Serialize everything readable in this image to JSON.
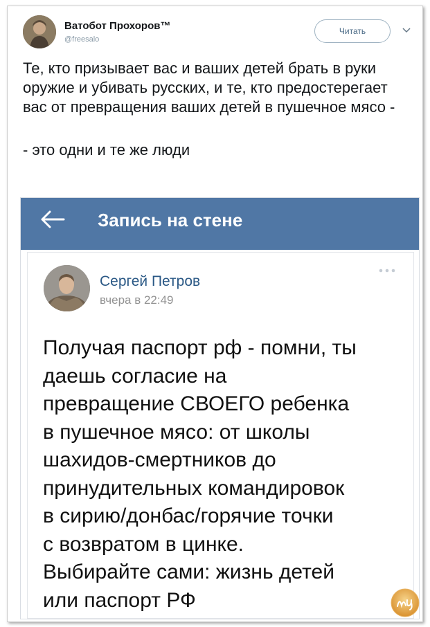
{
  "tweet": {
    "author_name": "Ватобот Прохоров™",
    "author_handle": "@freesalo",
    "follow_label": "Читать",
    "text_main": "Те, кто призывает вас и ваших детей брать в руки оружие и убивать русских, и те, кто предостерегает вас от превращения ваших детей в пушечное мясо -",
    "text_end": "- это одни и те же люди",
    "icons": {
      "avatar": "author-avatar",
      "menu": "chevron-down-icon"
    }
  },
  "vk": {
    "header_title": "Запись на стене",
    "header_color": "#5077a5",
    "post": {
      "author": "Сергей Петров",
      "time": "вчера в 22:49",
      "text": "Получая паспорт рф - помни, ты\nдаешь согласие на\nпревращение СВОЕГО ребенка\nв пушечное мясо: от школы\nшахидов-смертников до\nпринудительных командировок\nв сирию/донбас/горячие точки\nс возвратом в цинке.\nВыбирайте сами: жизнь детей\nили паспорт РФ"
    }
  },
  "watermark": {
    "text": "Nyka"
  }
}
